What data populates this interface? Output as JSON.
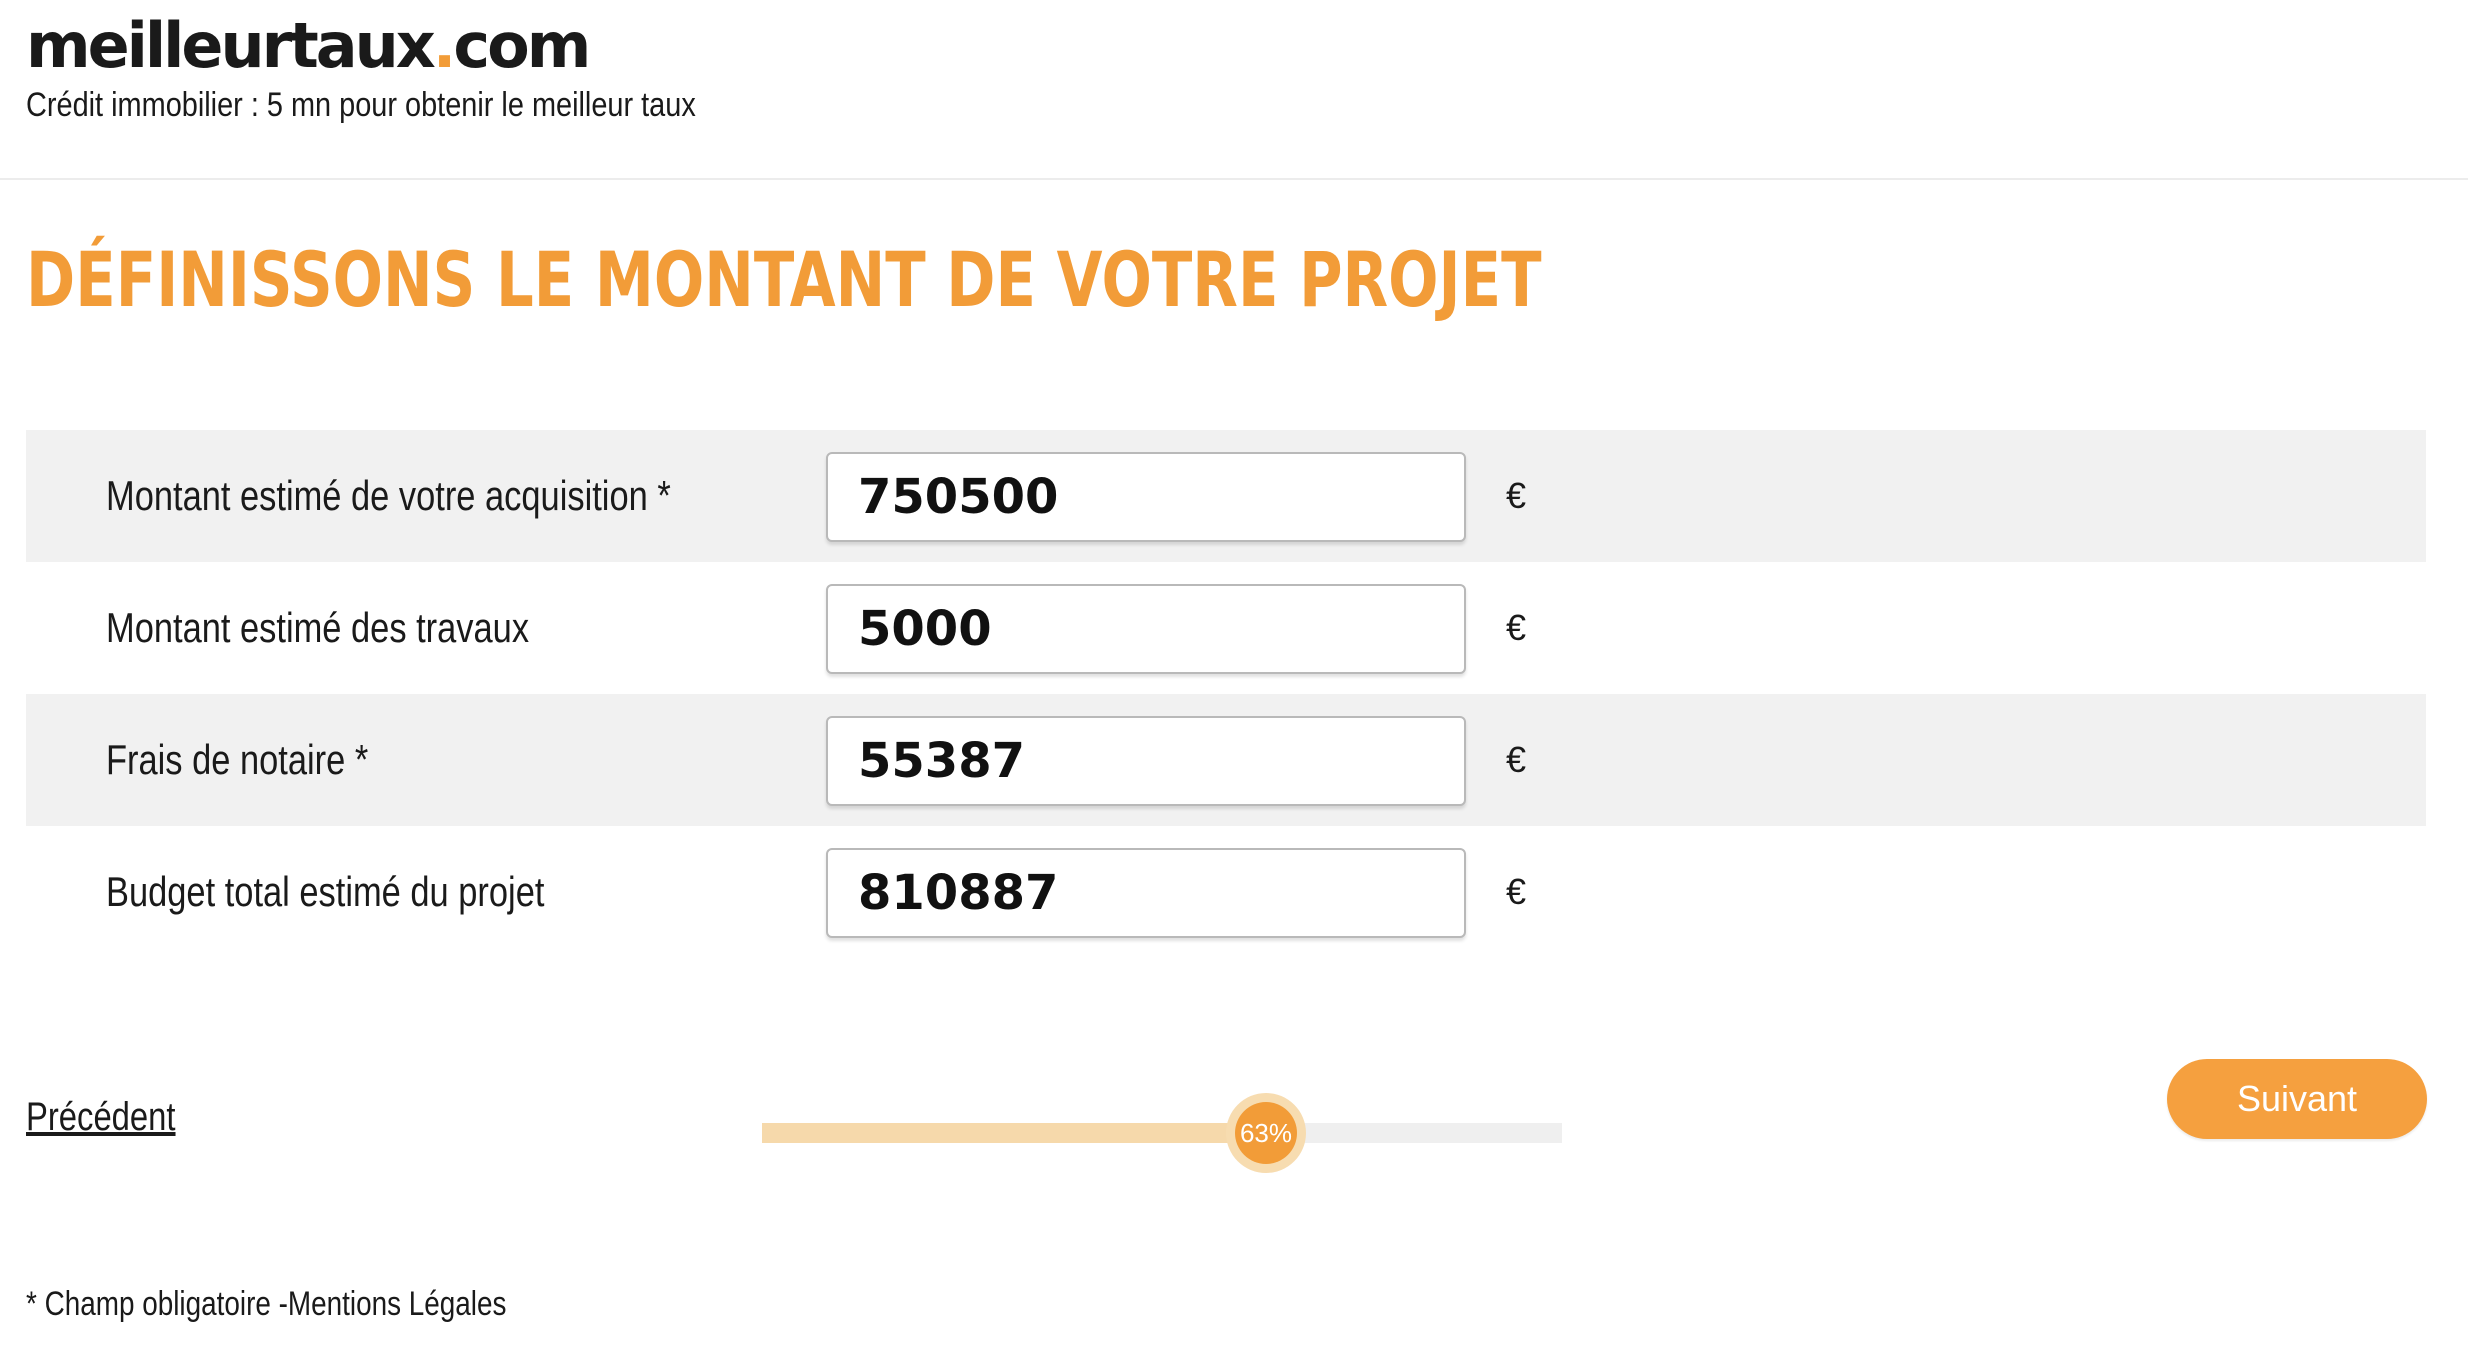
{
  "header": {
    "logo_main": "meilleurtaux",
    "logo_dot": ".",
    "logo_tld": "com",
    "tagline": "Crédit immobilier : 5 mn pour obtenir le meilleur taux"
  },
  "page_title": "DÉFINISSONS LE MONTANT DE VOTRE PROJET",
  "form": {
    "rows": [
      {
        "label": "Montant estimé de votre acquisition *",
        "value": "750500",
        "currency": "€"
      },
      {
        "label": "Montant estimé des travaux",
        "value": "5000",
        "currency": "€"
      },
      {
        "label": "Frais de notaire *",
        "value": "55387",
        "currency": "€"
      },
      {
        "label": "Budget total estimé du projet",
        "value": "810887",
        "currency": "€"
      }
    ]
  },
  "navigation": {
    "prev_label": "Précédent",
    "next_label": "Suivant"
  },
  "progress": {
    "percent": 63,
    "label": "63%"
  },
  "footer": {
    "note": "* Champ obligatoire -Mentions Légales"
  },
  "colors": {
    "accent": "#f29c38",
    "progress_fill": "#f6d9ab",
    "row_shade": "#f1f1f1"
  }
}
